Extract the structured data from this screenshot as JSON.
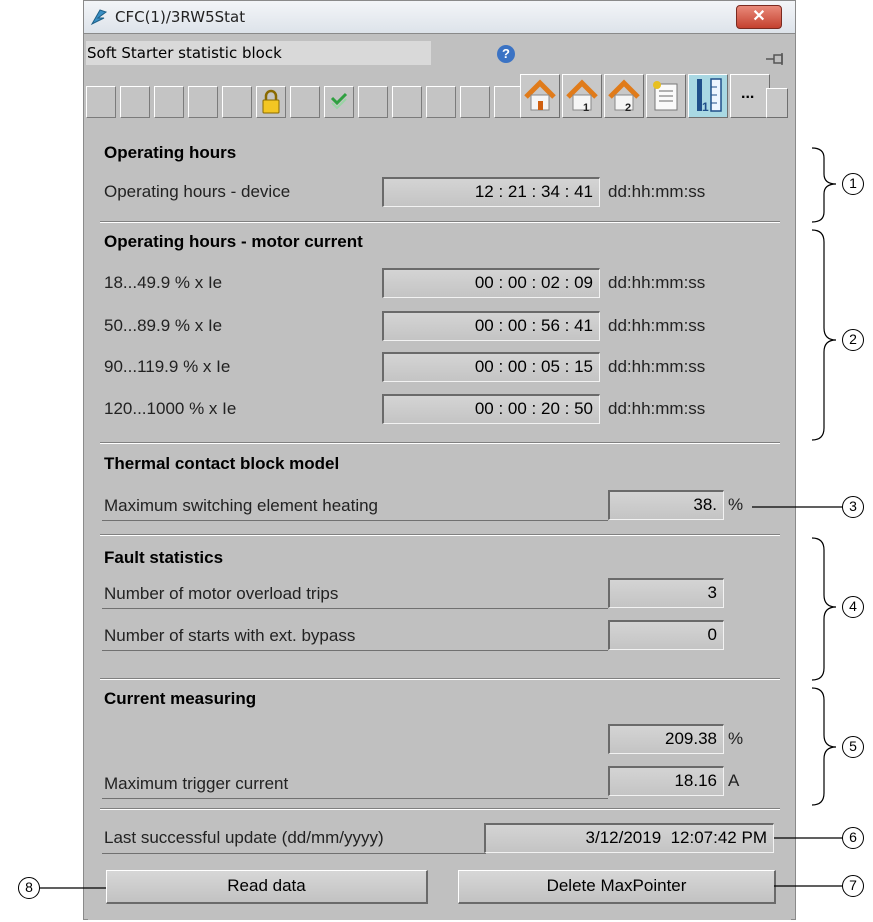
{
  "window": {
    "title": "CFC(1)/3RW5Stat",
    "close_glyph": "✕"
  },
  "toolbar": {
    "block_name": "Soft Starter statistic block",
    "more_label": "...",
    "icons": [
      "help-icon",
      "lock-icon",
      "check-icon",
      "home-icon",
      "home-1-icon",
      "home-2-icon",
      "notes-icon",
      "ruler-icon",
      "pin-icon"
    ]
  },
  "sections": {
    "operating_hours": {
      "heading": "Operating hours",
      "device_label": "Operating hours - device",
      "device_value": "12 : 21 : 34 : 41",
      "unit": "dd:hh:mm:ss"
    },
    "motor_current": {
      "heading": "Operating hours - motor current",
      "rows": [
        {
          "label": "18...49.9 % x Ie",
          "value": "00 : 00 : 02 : 09",
          "unit": "dd:hh:mm:ss"
        },
        {
          "label": "50...89.9 % x Ie",
          "value": "00 : 00 : 56 : 41",
          "unit": "dd:hh:mm:ss"
        },
        {
          "label": "90...119.9 % x Ie",
          "value": "00 : 00 : 05 : 15",
          "unit": "dd:hh:mm:ss"
        },
        {
          "label": "120...1000 % x Ie",
          "value": "00 : 00 : 20 : 50",
          "unit": "dd:hh:mm:ss"
        }
      ]
    },
    "thermal": {
      "heading": "Thermal contact block model",
      "label": "Maximum switching element heating",
      "value": "38.",
      "unit": "%"
    },
    "fault": {
      "heading": "Fault statistics",
      "rows": [
        {
          "label": "Number of motor overload trips",
          "value": "3"
        },
        {
          "label": "Number of starts with ext. bypass",
          "value": "0"
        }
      ]
    },
    "current": {
      "heading": "Current measuring",
      "percent_value": "209.38",
      "percent_unit": "%",
      "trigger_label": "Maximum trigger current",
      "trigger_value": "18.16",
      "trigger_unit": "A"
    },
    "update": {
      "label": "Last successful update (dd/mm/yyyy)",
      "value": "3/12/2019  12:07:42 PM"
    }
  },
  "buttons": {
    "read": "Read data",
    "delete": "Delete MaxPointer"
  },
  "callouts": [
    "1",
    "2",
    "3",
    "4",
    "5",
    "6",
    "7",
    "8"
  ],
  "colors": {
    "panel": "#c0c0c0",
    "close": "#c4412f",
    "active_tool": "#a9d8e3"
  }
}
